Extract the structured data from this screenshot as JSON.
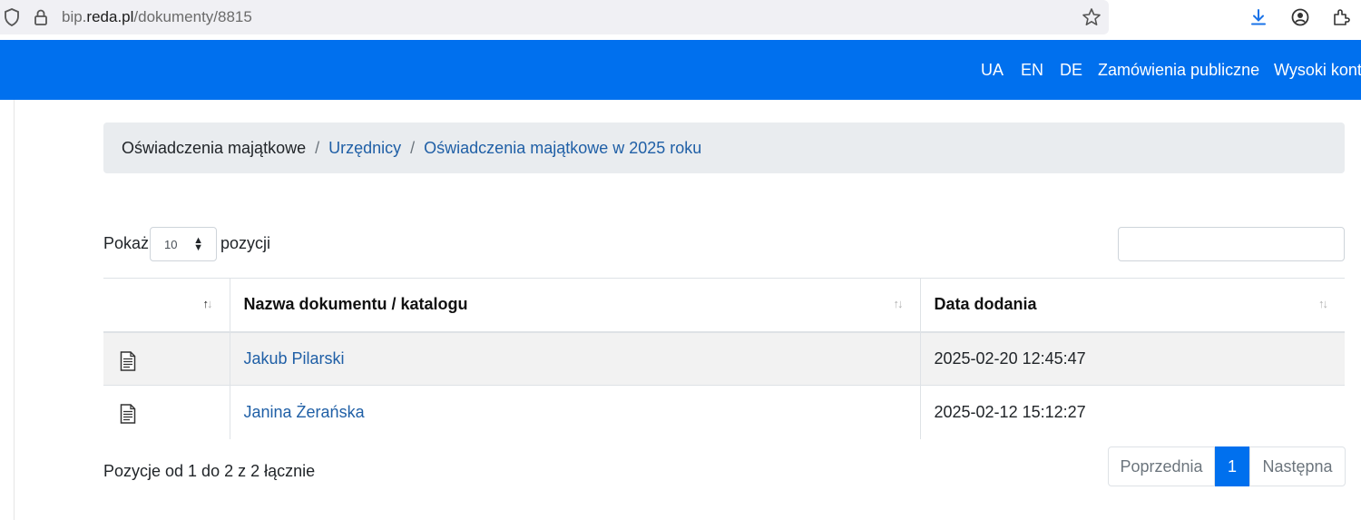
{
  "browser": {
    "url_prefix": "bip.",
    "url_domain": "reda.pl",
    "url_path": "/dokumenty/8815"
  },
  "topnav": {
    "links": [
      "UA",
      "EN",
      "DE",
      "Zamówienia publiczne",
      "Wysoki kont"
    ]
  },
  "breadcrumb": {
    "current": "Oświadczenia majątkowe",
    "separator": "/",
    "items": [
      "Urzędnicy",
      "Oświadczenia majątkowe w 2025 roku"
    ]
  },
  "length_menu": {
    "prefix": "Pokaż",
    "value": "10",
    "suffix": "pozycji"
  },
  "table": {
    "columns": [
      "",
      "Nazwa dokumentu / katalogu",
      "Data dodania"
    ],
    "rows": [
      {
        "icon": "document-icon",
        "name": "Jakub Pilarski",
        "date": "2025-02-20 12:45:47"
      },
      {
        "icon": "document-icon",
        "name": "Janina Żerańska",
        "date": "2025-02-12 15:12:27"
      }
    ]
  },
  "info": "Pozycje od 1 do 2 z 2 łącznie",
  "pagination": {
    "prev": "Poprzednia",
    "current": "1",
    "next": "Następna"
  },
  "colors": {
    "nav": "#0070ee",
    "link": "#1f5fa6"
  }
}
